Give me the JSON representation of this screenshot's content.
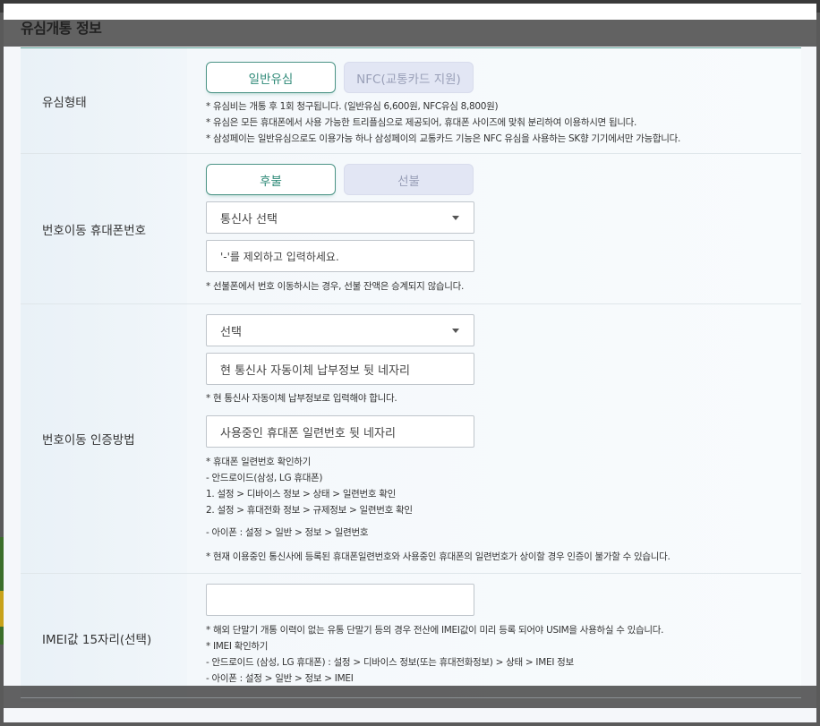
{
  "modal": {
    "title": "유심개통 정보"
  },
  "rows": {
    "sim_type": {
      "label": "유심형태",
      "option_general": "일반유심",
      "option_nfc": "NFC(교통카드 지원)",
      "notes": [
        "* 유심비는 개통 후 1회 청구됩니다. (일반유심 6,600원, NFC유심 8,800원)",
        "* 유심은 모든 휴대폰에서 사용 가능한 트리플심으로 제공되어, 휴대폰 사이즈에 맞춰 분리하여 이용하시면 됩니다.",
        "* 삼성페이는 일반유심으로도 이용가능 하나 삼성페이의 교통카드 기능은 NFC 유심을 사용하는 SK향 기기에서만 가능합니다."
      ]
    },
    "port_number": {
      "label": "번호이동 휴대폰번호",
      "option_postpaid": "후불",
      "option_prepaid": "선불",
      "carrier_select": "통신사 선택",
      "phone_placeholder": "'-'를 제외하고 입력하세요.",
      "note": "* 선불폰에서 번호 이동하시는 경우, 선불 잔액은 승계되지 않습니다."
    },
    "auth_method": {
      "label": "번호이동 인증방법",
      "method_select": "선택",
      "autopay_placeholder": "현 통신사 자동이체 납부정보 뒷 네자리",
      "autopay_note": "* 현 통신사 자동이체 납부정보로 입력해야 합니다.",
      "serial_placeholder": "사용중인 휴대폰 일련번호 뒷 네자리",
      "serial_notes": [
        "* 휴대폰 일련번호 확인하기",
        "- 안드로이드(삼성, LG 휴대폰)",
        "1. 설정 > 디바이스 정보 > 상태 > 일련번호 확인",
        "2. 설정 > 휴대전화 정보 > 규제정보 > 일련번호 확인"
      ],
      "iphone_note": "- 아이폰 : 설정 > 일반 > 정보 > 일련번호",
      "mismatch_note": "* 현재 이용중인 통신사에 등록된 휴대폰일련번호와 사용중인 휴대폰의 일련번호가 상이할 경우 인증이 불가할 수 있습니다."
    },
    "imei": {
      "label": "IMEI값 15자리(선택)",
      "input_value": "",
      "notes": [
        "* 해외 단말기 개통 이력이 없는 유통 단말기 등의 경우 전산에 IMEI값이 미리 등록 되어야 USIM을 사용하실 수 있습니다.",
        "* IMEI 확인하기",
        "- 안드로이드 (삼성, LG 휴대폰) : 설정 > 디바이스 정보(또는 휴대전화정보) > 상태 > IMEI 정보",
        "- 아이폰 : 설정 > 일반 > 정보 > IMEI"
      ]
    }
  },
  "colors": {
    "accent": "#4a9385",
    "label_bg": "#e9f1f7",
    "inactive_btn": "#e2e6f4"
  }
}
